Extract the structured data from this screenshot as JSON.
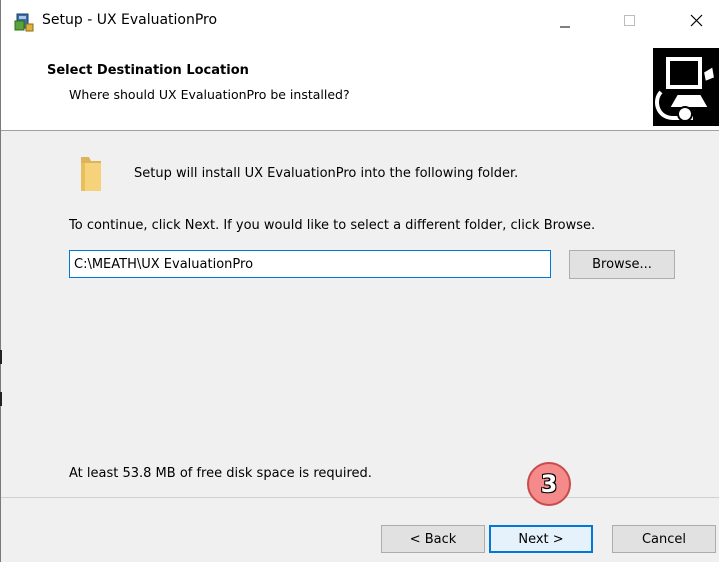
{
  "window": {
    "title": "Setup - UX EvaluationPro",
    "icon": "setup-installer-icon",
    "controls": [
      "minimize-icon",
      "maximize-icon",
      "close-icon"
    ]
  },
  "header": {
    "title": "Select Destination Location",
    "subtitle": "Where should UX EvaluationPro be installed?",
    "icon": "computer-install-icon"
  },
  "body": {
    "folder_icon": "folder-icon",
    "intro": "Setup will install UX EvaluationPro into the following folder.",
    "instructions": "To continue, click Next. If you would like to select a different folder, click Browse.",
    "path_value": "C:\\MEATH\\UX EvaluationPro",
    "browse_label": "Browse...",
    "disk_space": "At least 53.8 MB of free disk space is required."
  },
  "footer": {
    "back_label": "< Back",
    "next_label": "Next >",
    "cancel_label": "Cancel"
  },
  "annotation": {
    "step_number": "3",
    "color": "#f48a8a"
  },
  "colors": {
    "accent": "#0078d7",
    "dialog_bg": "#f0f0f0",
    "button_bg": "#e1e1e1"
  }
}
